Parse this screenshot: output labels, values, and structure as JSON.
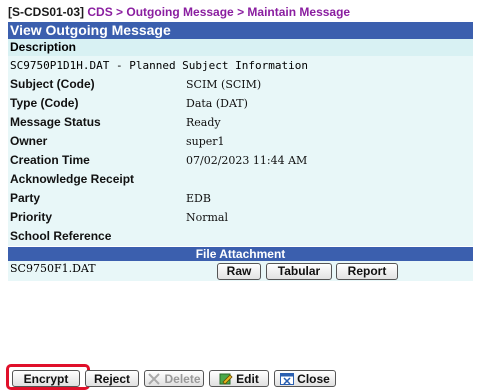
{
  "breadcrumb": {
    "code": "[S-CDS01-03]",
    "path": "CDS > Outgoing Message > Maintain Message"
  },
  "panel": {
    "title": "View Outgoing Message",
    "description_label": "Description",
    "description_value": "SC9750P1D1H.DAT - Planned Subject Information"
  },
  "fields": [
    {
      "label": "Subject (Code)",
      "value": "SCIM (SCIM)"
    },
    {
      "label": "Type (Code)",
      "value": "Data (DAT)"
    },
    {
      "label": "Message Status",
      "value": "Ready"
    },
    {
      "label": "Owner",
      "value": "super1"
    },
    {
      "label": "Creation Time",
      "value": "07/02/2023 11:44 AM"
    },
    {
      "label": "Acknowledge Receipt",
      "value": ""
    },
    {
      "label": "Party",
      "value": "EDB"
    },
    {
      "label": "Priority",
      "value": "Normal"
    },
    {
      "label": "School Reference",
      "value": ""
    }
  ],
  "attachment": {
    "header": "File Attachment",
    "file_name": "SC9750F1.DAT",
    "raw_label": "Raw",
    "tabular_label": "Tabular",
    "report_label": "Report"
  },
  "actions": {
    "encrypt_label": "Encrypt",
    "reject_label": "Reject",
    "delete_label": "Delete",
    "edit_label": "Edit",
    "close_label": "Close"
  },
  "colors": {
    "title_bg": "#3b5fae",
    "row_bg": "#e8f7f8",
    "highlight": "#e0102a",
    "breadcrumb_path": "#8a1ea0"
  }
}
